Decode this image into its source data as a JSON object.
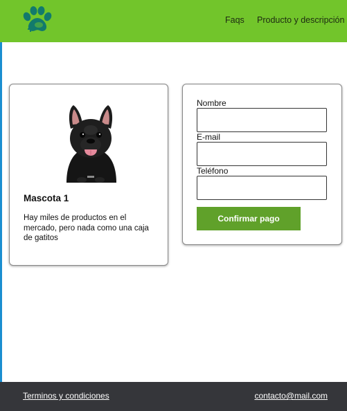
{
  "header": {
    "logo_icon": "paw-plus-icon",
    "nav": [
      {
        "label": "Faqs"
      },
      {
        "label": "Producto y descripción"
      }
    ],
    "background_color": "#72c52b"
  },
  "product_card": {
    "image_icon": "french-bulldog-photo",
    "title": "Mascota 1",
    "description": "Hay miles de productos en el mercado, pero nada como una caja de gatitos"
  },
  "form": {
    "fields": [
      {
        "label": "Nombre",
        "value": ""
      },
      {
        "label": "E-mail",
        "value": ""
      },
      {
        "label": "Teléfono",
        "value": ""
      }
    ],
    "submit_label": "Confirmar pago",
    "button_color": "#60a12a"
  },
  "footer": {
    "terms_label": "Terminos y condiciones",
    "contact_email": "contacto@mail.com",
    "background_color": "#35363a"
  }
}
